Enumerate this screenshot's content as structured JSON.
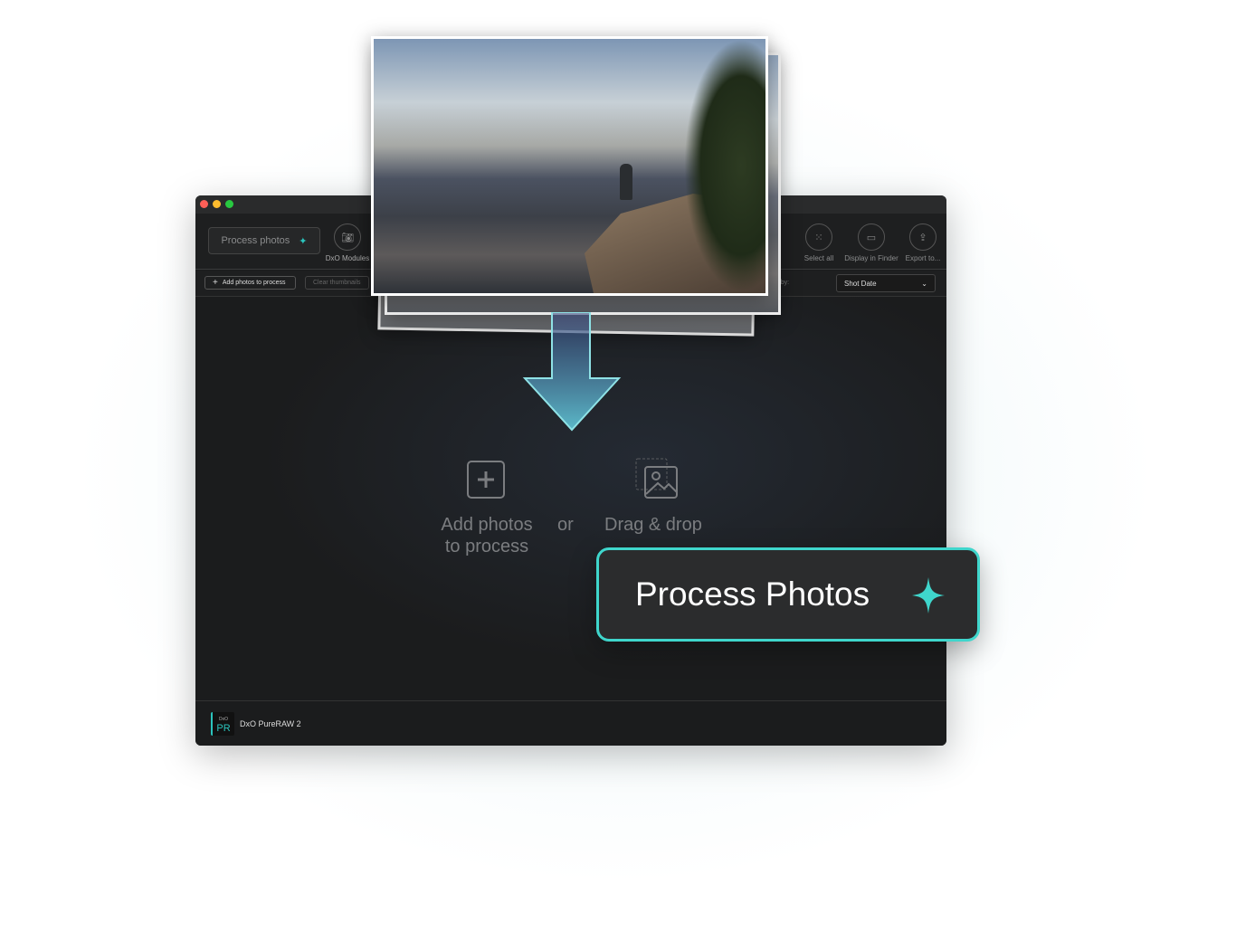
{
  "window": {
    "traffic_lights": [
      "#fe5f57",
      "#febc2e",
      "#28c840"
    ]
  },
  "toolbar": {
    "process_photos_label": "Process photos",
    "dxo_modules_label": "DxO Modules",
    "select_all_label": "Select all",
    "display_in_finder_label": "Display in Finder",
    "export_label": "Export to..."
  },
  "subbar": {
    "add_photos_label": "Add photos to process",
    "clear_thumbnails_label": "Clear thumbnails",
    "sort_by_label": "Sort by:",
    "sort_value": "Shot Date"
  },
  "main": {
    "add_line1": "Add photos",
    "add_line2": "to process",
    "or_label": "or",
    "drag_label": "Drag & drop"
  },
  "footer": {
    "app_name": "DxO PureRAW 2",
    "logo_text": "PR",
    "logo_small": "DxO"
  },
  "cta": {
    "label": "Process Photos",
    "accent": "#3fd6cc"
  }
}
